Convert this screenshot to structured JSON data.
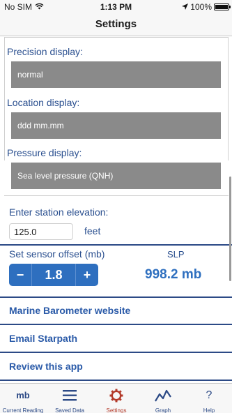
{
  "status_bar": {
    "carrier": "No SIM",
    "time": "1:13 PM",
    "battery": "100%",
    "battery_level": 1.0
  },
  "nav": {
    "title": "Settings"
  },
  "precision": {
    "label": "Precision display:",
    "value": "normal"
  },
  "location": {
    "label": "Location display:",
    "value": "ddd mm.mm"
  },
  "pressure": {
    "label": "Pressure display:",
    "value": "Sea level pressure (QNH)"
  },
  "elevation": {
    "label": "Enter station elevation:",
    "value": "125.0",
    "unit": "feet"
  },
  "offset": {
    "label": "Set sensor offset  (mb)",
    "minus": "−",
    "value": "1.8",
    "plus": "+"
  },
  "slp": {
    "label": "SLP",
    "value": "998.2 mb"
  },
  "links": {
    "website": "Marine Barometer website",
    "email": "Email Starpath",
    "review": "Review this app"
  },
  "tabs": [
    {
      "label": "Current Reading",
      "icon_text": "mb",
      "icon": "mb-text-icon"
    },
    {
      "label": "Saved Data",
      "icon": "list-icon"
    },
    {
      "label": "Settings",
      "icon": "gear-icon"
    },
    {
      "label": "Graph",
      "icon": "graph-icon"
    },
    {
      "label": "Help",
      "icon_text": "?",
      "icon": "question-icon"
    }
  ],
  "colors": {
    "accent": "#2e6fbf",
    "link": "#2a5aa8",
    "divider": "#2c4a86",
    "active_tab": "#b33a2a",
    "field_gray": "#8a8a8a"
  }
}
